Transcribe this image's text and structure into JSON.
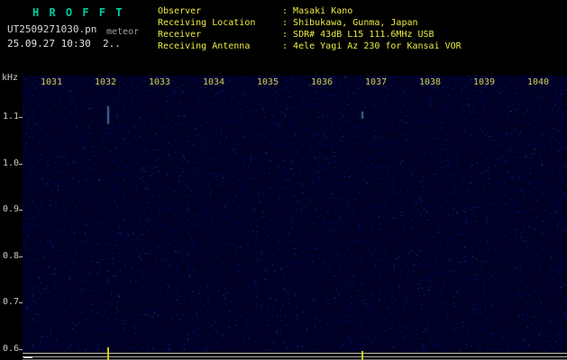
{
  "header": {
    "logo": "H R O F F T",
    "filename": "UT2509271030.pn",
    "station": "meteor",
    "datetime": "25.09.27 10:30  2..",
    "separator": ": ",
    "info_rows": [
      {
        "label": "Observer",
        "value": "Masaki Kano"
      },
      {
        "label": "Receiving Location",
        "value": "Shibukawa, Gunma, Japan"
      },
      {
        "label": "Receiver",
        "value": "SDR# 43dB L15 111.6MHz USB"
      },
      {
        "label": "Receiving Antenna",
        "value": "4ele Yagi Az 230 for Kansai VOR"
      }
    ]
  },
  "chart_data": {
    "type": "heatmap",
    "title": "HROFFT radio meteor echo spectrogram",
    "ylabel": "kHz",
    "x_ticks": [
      "1031",
      "1032",
      "1033",
      "1034",
      "1035",
      "1036",
      "1037",
      "1038",
      "1039",
      "1040"
    ],
    "y_ticks": [
      "1.1",
      "1.0",
      "0.9",
      "0.8",
      "0.7",
      "0.6"
    ],
    "x_range": [
      "10:30",
      "10:40"
    ],
    "y_range_khz": [
      0.55,
      1.15
    ],
    "grid": false,
    "legend": "none",
    "echo_events": [
      {
        "time": "10:32.0",
        "freq_khz": 1.1
      },
      {
        "time": "10:36.8",
        "freq_khz": 1.1
      }
    ],
    "colors": {
      "logo": "#00cba4",
      "header_text": "#ecec45",
      "tick_label": "#cfcf5a",
      "axis_label": "#c9c9c9",
      "echo": "#7ad0ff",
      "event_marker": "#cfcf00",
      "noise_base": "#000020",
      "noise_palette": [
        "#00002e",
        "#00003c",
        "#00004e",
        "#0a1c66",
        "#1e4c8c"
      ]
    }
  }
}
